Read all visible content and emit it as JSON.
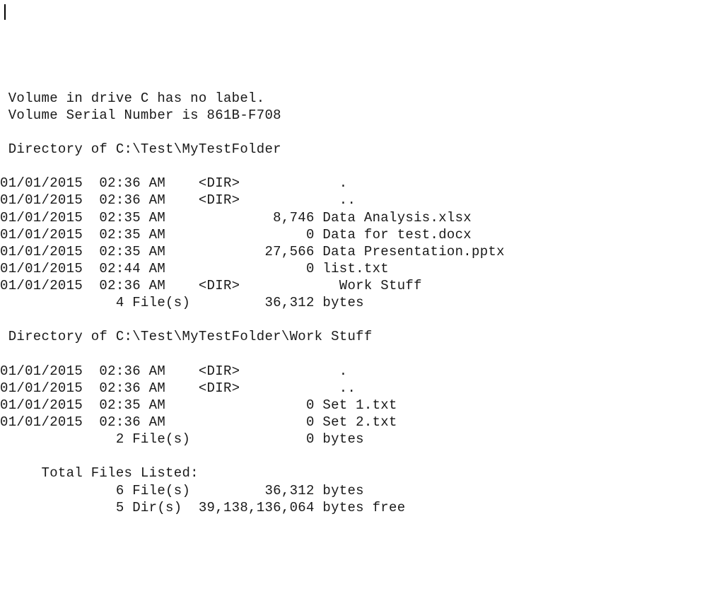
{
  "header": {
    "volume_line": " Volume in drive C has no label.",
    "serial_line": " Volume Serial Number is 861B-F708"
  },
  "dirs": [
    {
      "heading": " Directory of C:\\Test\\MyTestFolder",
      "entries": [
        {
          "date": "01/01/2015",
          "time": "02:36 AM",
          "dir": "<DIR>",
          "size": "",
          "name": "."
        },
        {
          "date": "01/01/2015",
          "time": "02:36 AM",
          "dir": "<DIR>",
          "size": "",
          "name": ".."
        },
        {
          "date": "01/01/2015",
          "time": "02:35 AM",
          "dir": "",
          "size": "8,746",
          "name": "Data Analysis.xlsx"
        },
        {
          "date": "01/01/2015",
          "time": "02:35 AM",
          "dir": "",
          "size": "0",
          "name": "Data for test.docx"
        },
        {
          "date": "01/01/2015",
          "time": "02:35 AM",
          "dir": "",
          "size": "27,566",
          "name": "Data Presentation.pptx"
        },
        {
          "date": "01/01/2015",
          "time": "02:44 AM",
          "dir": "",
          "size": "0",
          "name": "list.txt"
        },
        {
          "date": "01/01/2015",
          "time": "02:36 AM",
          "dir": "<DIR>",
          "size": "",
          "name": "Work Stuff"
        }
      ],
      "summary": {
        "file_count": "4",
        "bytes": "36,312"
      }
    },
    {
      "heading": " Directory of C:\\Test\\MyTestFolder\\Work Stuff",
      "entries": [
        {
          "date": "01/01/2015",
          "time": "02:36 AM",
          "dir": "<DIR>",
          "size": "",
          "name": "."
        },
        {
          "date": "01/01/2015",
          "time": "02:36 AM",
          "dir": "<DIR>",
          "size": "",
          "name": ".."
        },
        {
          "date": "01/01/2015",
          "time": "02:35 AM",
          "dir": "",
          "size": "0",
          "name": "Set 1.txt"
        },
        {
          "date": "01/01/2015",
          "time": "02:36 AM",
          "dir": "",
          "size": "0",
          "name": "Set 2.txt"
        }
      ],
      "summary": {
        "file_count": "2",
        "bytes": "0"
      }
    }
  ],
  "totals": {
    "heading": "     Total Files Listed:",
    "files": {
      "count": "6",
      "bytes": "36,312"
    },
    "dirs": {
      "count": "5",
      "free": "39,138,136,064"
    }
  }
}
